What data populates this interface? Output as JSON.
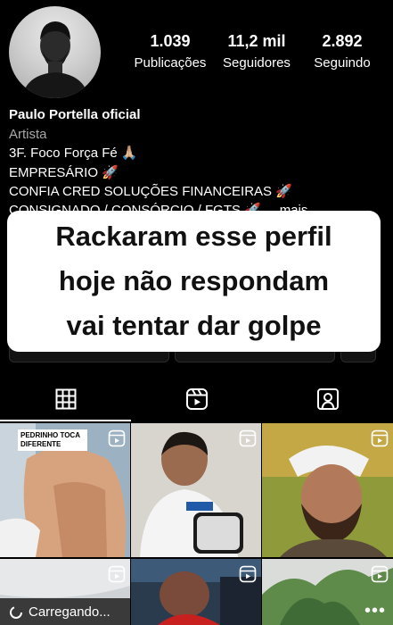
{
  "profile": {
    "stats": [
      {
        "value": "1.039",
        "label": "Publicações"
      },
      {
        "value": "11,2 mil",
        "label": "Seguidores"
      },
      {
        "value": "2.892",
        "label": "Seguindo"
      }
    ],
    "name": "Paulo Portella oficial",
    "category": "Artista",
    "bio_lines": [
      "3F. Foco Força Fé 🙏🏼",
      "EMPRESÁRIO 🚀",
      "CONFIA CRED SOLUÇÕES FINANCEIRAS 🚀",
      "CONSIGNADO / CONSÓRCIO / FGTS 🚀 ... mais"
    ]
  },
  "overlay": {
    "lines": [
      "Rackaram esse perfil",
      "hoje não respondam",
      "vai tentar dar golpe"
    ]
  },
  "tabs": [
    {
      "icon": "grid-icon"
    },
    {
      "icon": "reels-icon"
    },
    {
      "icon": "tagged-icon"
    }
  ],
  "grid": {
    "first_post_caption": "PEDRINHO TOCA DIFERENTE",
    "loading_text": "Carregando...",
    "more_label": "•••"
  }
}
